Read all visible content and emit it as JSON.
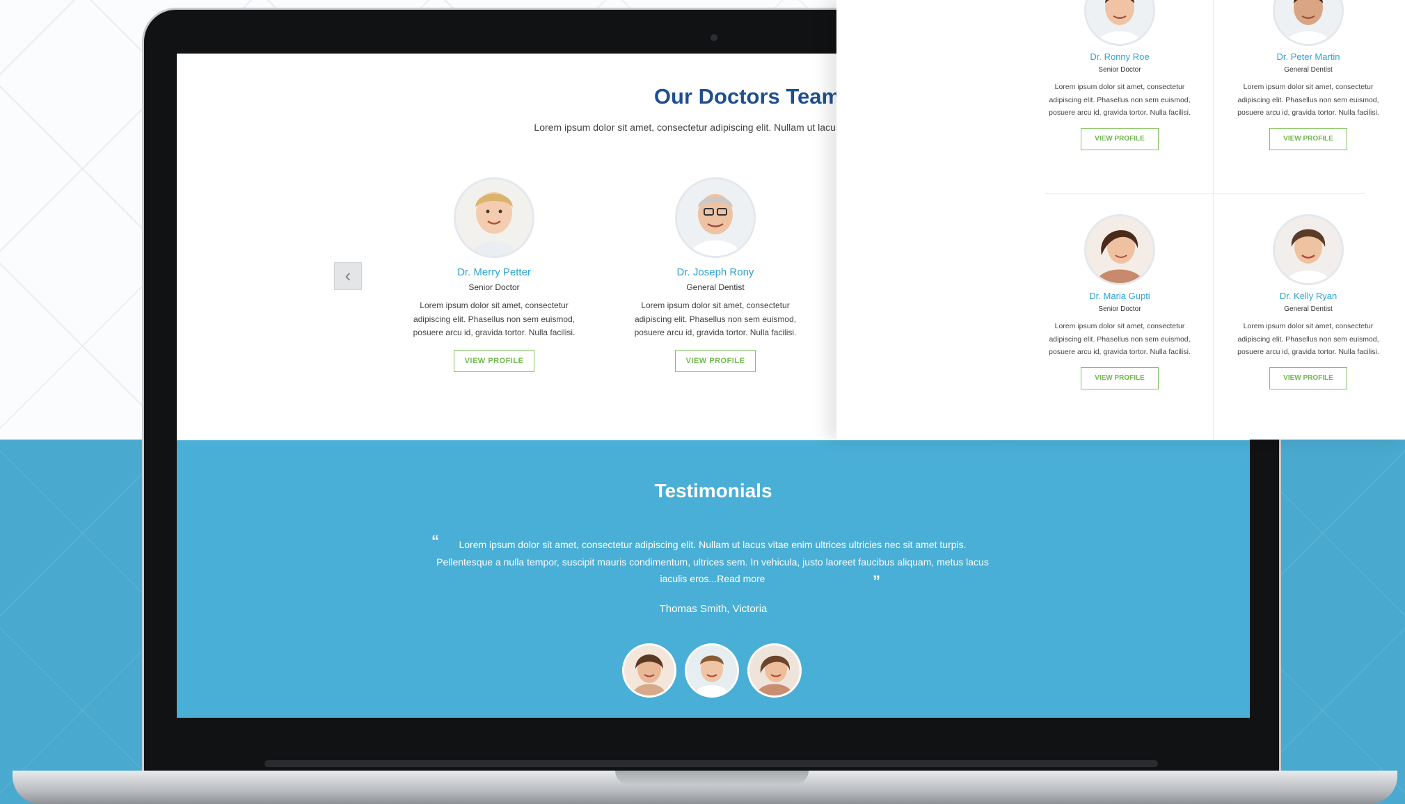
{
  "doctors_section": {
    "title": "Our Doctors Team",
    "intro": "Lorem ipsum dolor sit amet, consectetur adipiscing elit. Nullam ut lacus ultricies nec sit amet turpis.",
    "prev_icon": "chevron-left-icon",
    "doctors": [
      {
        "name": "Dr. Merry Petter",
        "role": "Senior Doctor",
        "bio": "Lorem ipsum dolor sit amet, consectetur adipiscing elit. Phasellus non sem euismod, posuere arcu id, gravida tortor. Nulla facilisi.",
        "button": "VIEW PROFILE"
      },
      {
        "name": "Dr. Joseph Rony",
        "role": "General Dentist",
        "bio": "Lorem ipsum dolor sit amet, consectetur adipiscing elit. Phasellus non sem euismod, posuere arcu id, gravida tortor. Nulla facilisi.",
        "button": "VIEW PROFILE"
      }
    ]
  },
  "testimonials": {
    "title": "Testimonials",
    "quote": "Lorem ipsum dolor sit amet, consectetur adipiscing elit. Nullam ut lacus vitae enim ultrices ultricies nec sit amet turpis. Pellentesque a nulla tempor, suscipit mauris condimentum, ultrices sem. In vehicula, justo laoreet faucibus aliquam, metus lacus iaculis eros...Read more",
    "quote_open": "“",
    "quote_close": "”",
    "author": "Thomas Smith, Victoria",
    "avatars": [
      "avatar-woman-1",
      "avatar-man",
      "avatar-woman-2"
    ]
  },
  "overlay_panel": {
    "doctors": [
      {
        "name": "Dr. Ronny Roe",
        "role": "Senior Doctor",
        "bio": "Lorem ipsum dolor sit amet, consectetur adipiscing elit. Phasellus non sem euismod, posuere arcu id, gravida tortor. Nulla facilisi.",
        "button": "VIEW PROFILE"
      },
      {
        "name": "Dr. Peter Martin",
        "role": "General Dentist",
        "bio": "Lorem ipsum dolor sit amet, consectetur adipiscing elit. Phasellus non sem euismod, posuere arcu id, gravida tortor. Nulla facilisi.",
        "button": "VIEW PROFILE"
      },
      {
        "name": "Dr. Maria Gupti",
        "role": "Senior Doctor",
        "bio": "Lorem ipsum dolor sit amet, consectetur adipiscing elit. Phasellus non sem euismod, posuere arcu id, gravida tortor. Nulla facilisi.",
        "button": "VIEW PROFILE"
      },
      {
        "name": "Dr. Kelly Ryan",
        "role": "General Dentist",
        "bio": "Lorem ipsum dolor sit amet, consectetur adipiscing elit. Phasellus non sem euismod, posuere arcu id, gravida tortor. Nulla facilisi.",
        "button": "VIEW PROFILE"
      }
    ]
  },
  "colors": {
    "heading_blue": "#1f4f8e",
    "name_blue": "#2ba2d4",
    "button_green": "#6fb84c",
    "testimonial_bg": "#4aafd6"
  }
}
